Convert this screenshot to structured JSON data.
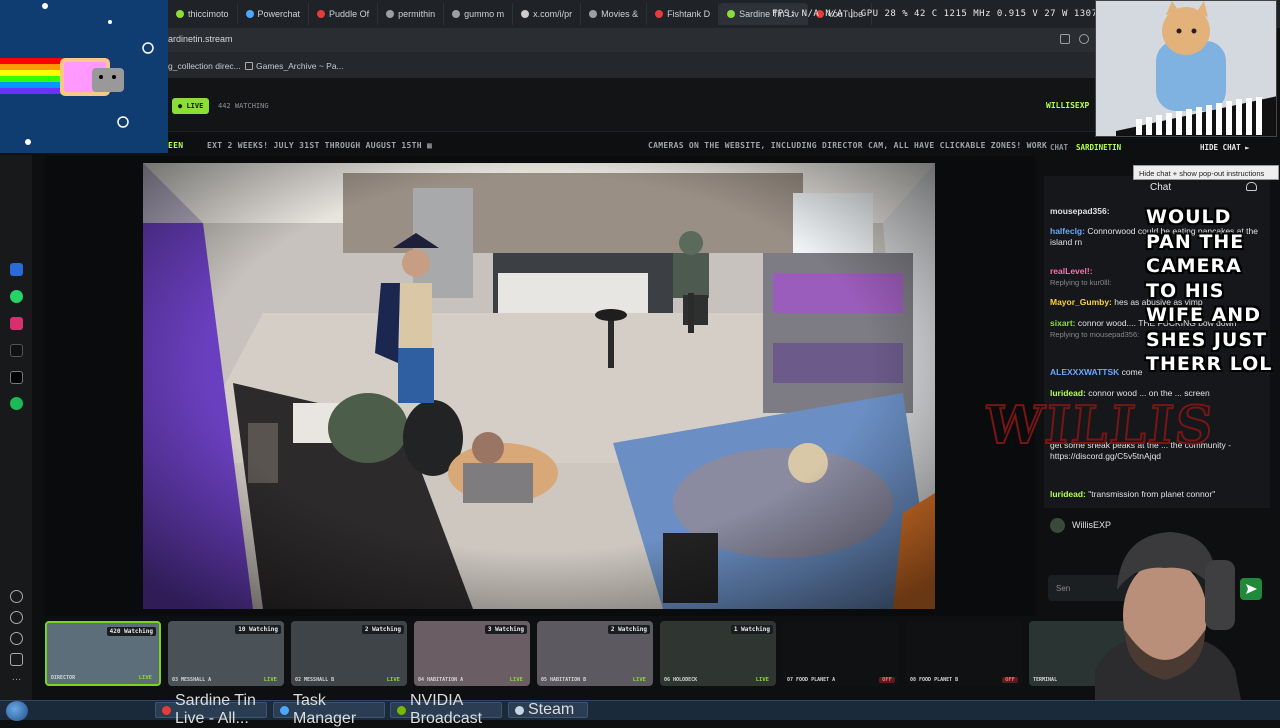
{
  "browser": {
    "tabs": [
      {
        "label": "thiccimoto",
        "color": "#8cdc3c"
      },
      {
        "label": "Powerchat",
        "color": "#4aa8ff"
      },
      {
        "label": "Puddle Of",
        "color": "#e63b3b"
      },
      {
        "label": "permithin",
        "color": "#9aa0a6"
      },
      {
        "label": "gummo m",
        "color": "#9aa0a6"
      },
      {
        "label": "x.com/i/pr",
        "color": "#cccccc"
      },
      {
        "label": "Movies &",
        "color": "#9aa0a6"
      },
      {
        "label": "Fishtank D",
        "color": "#e63b3b"
      },
      {
        "label": "Sardine Tin Liv",
        "color": "#8cdc3c",
        "active": true
      },
      {
        "label": "YouTube",
        "color": "#e63b3b"
      }
    ],
    "url": "ardinetin.stream",
    "bookmarks": [
      "g_collection direc...",
      "Games_Archive ~ Pa..."
    ]
  },
  "osd": "FPS: N/A  N/A  |  GPU 28 %  42 C  1215 MHz  0.915 V  27 W  1307 RPM",
  "header": {
    "live_label": "LIVE",
    "watching": "442 WATCHING",
    "streamer": "WILLISEXP"
  },
  "ticker": {
    "left_fragment": "EEN",
    "main": "EXT 2 WEEKS! JULY 31ST THROUGH AUGUST 15TH ▦",
    "right": "CAMERAS ON THE WEBSITE, INCLUDING DIRECTOR CAM, ALL HAVE CLICKABLE ZONES! WORK"
  },
  "chat": {
    "label": "CHAT",
    "channel": "SARDINETIN",
    "hide_label": "HIDE CHAT ►",
    "tooltip": "Hide chat + show pop-out instructions",
    "title": "Chat",
    "messages": [
      {
        "user": "mousepad356:",
        "color": "#e0e0e0",
        "text": ""
      },
      {
        "user": "halfeclg:",
        "color": "#6aa9ff",
        "text": "Connorwood could be eating pancakes at the island rn"
      },
      {
        "user": "realLevel!:",
        "color": "#ff6fae",
        "text": "",
        "reply": "Replying to kur0lll:"
      },
      {
        "user": "Mayor_Gumby:",
        "color": "#ffd23c",
        "text": "hes as abusive as vimp"
      },
      {
        "user": "sixart:",
        "color": "#8cdc3c",
        "text": "connor wood.... THE FUCKING bow down",
        "reply": "Replying to mousepad356:"
      },
      {
        "user": "ALEXXXWATTSK",
        "color": "#6aa9ff",
        "text": "come"
      },
      {
        "user": "luridead:",
        "color": "#b6ff4e",
        "text": "connor wood ... on the ... screen"
      },
      {
        "user": "",
        "color": "#e0e0e0",
        "text": "get some sneak peaks at the ... the community - https://discord.gg/C5v5tnAjqd"
      },
      {
        "user": "luridead:",
        "color": "#b6ff4e",
        "text": "\"transmission from planet connor\""
      }
    ],
    "input_placeholder": "Sen",
    "username": "WillisEXP"
  },
  "overlay": {
    "caption": "WOULD PAN THE CAMERA TO HIS WIFE AND SHES JUST THERR LOL",
    "logo": "WILLIS"
  },
  "thumbnails": [
    {
      "count": "420 Watching",
      "label": "DIRECTOR",
      "status": "LIVE",
      "selected": true,
      "tone": "#5b6e7a"
    },
    {
      "count": "10 Watching",
      "label": "03  MESSHALL A",
      "status": "LIVE",
      "tone": "#4a5257"
    },
    {
      "count": "2 Watching",
      "label": "02  MESSHALL B",
      "status": "LIVE",
      "tone": "#3e4448"
    },
    {
      "count": "3 Watching",
      "label": "04  HABITATION A",
      "status": "LIVE",
      "tone": "#6a5d63"
    },
    {
      "count": "2 Watching",
      "label": "05  HABITATION B",
      "status": "LIVE",
      "tone": "#5c5a60"
    },
    {
      "count": "1 Watching",
      "label": "06  HOLODECK",
      "status": "LIVE",
      "tone": "#2f3530"
    },
    {
      "count": "",
      "label": "07  FOOD PLANET A",
      "status": "OFF",
      "tone": "#101112"
    },
    {
      "count": "",
      "label": "08  FOOD PLANET B",
      "status": "OFF",
      "tone": "#101112"
    },
    {
      "count": "",
      "label": "TERMINAL",
      "status": "",
      "tone": "#2a3533"
    }
  ],
  "taskbar": {
    "items": [
      {
        "label": "Sardine Tin Live - All...",
        "color": "#e63b3b"
      },
      {
        "label": "Task Manager",
        "color": "#4aa8ff"
      },
      {
        "label": "NVIDIA Broadcast",
        "color": "#76b900"
      },
      {
        "label": "Steam",
        "color": "#c7d5e0"
      }
    ]
  },
  "colors": {
    "accent": "#8cdc3c",
    "brand_green": "#b6ff4e"
  }
}
